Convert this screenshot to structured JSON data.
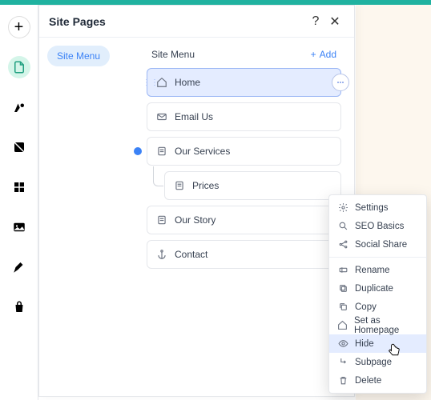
{
  "header": {
    "title": "Site Pages"
  },
  "tree": {
    "site_menu_chip": "Site Menu"
  },
  "menu": {
    "title": "Site Menu",
    "add_label": "Add",
    "pages": {
      "home": "Home",
      "email_us": "Email Us",
      "our_services": "Our Services",
      "prices": "Prices",
      "our_story": "Our Story",
      "contact": "Contact"
    }
  },
  "context_menu": {
    "settings": "Settings",
    "seo": "SEO Basics",
    "social": "Social Share",
    "rename": "Rename",
    "duplicate": "Duplicate",
    "copy": "Copy",
    "homepage": "Set as Homepage",
    "hide": "Hide",
    "subpage": "Subpage",
    "delete": "Delete"
  }
}
